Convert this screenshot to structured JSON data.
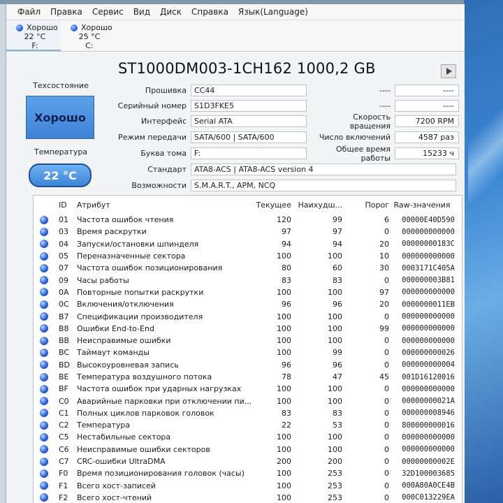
{
  "menu": [
    "Файл",
    "Правка",
    "Сервис",
    "Вид",
    "Диск",
    "Справка",
    "Язык(Language)"
  ],
  "disks": [
    {
      "status": "Хорошо",
      "temp": "22 °C",
      "letter": "F:"
    },
    {
      "status": "Хорошо",
      "temp": "25 °C",
      "letter": "C:"
    }
  ],
  "model_title": "ST1000DM003-1CH162 1000,2 GB",
  "left": {
    "health_label": "Техсостояние",
    "health_value": "Хорошо",
    "temp_label": "Температура",
    "temp_value": "22 °C"
  },
  "info": {
    "firmware": {
      "label": "Прошивка",
      "value": "CC44"
    },
    "serial": {
      "label": "Серийный номер",
      "value": "S1D3FKE5"
    },
    "interface": {
      "label": "Интерфейс",
      "value": "Serial ATA"
    },
    "transfer": {
      "label": "Режим передачи",
      "value": "SATA/600 | SATA/600"
    },
    "volume": {
      "label": "Буква тома",
      "value": "F:"
    },
    "standard": {
      "label": "Стандарт",
      "value": "ATA8-ACS | ATA8-ACS version 4"
    },
    "features": {
      "label": "Возможности",
      "value": "S.M.A.R.T., APM, NCQ"
    },
    "blank1": {
      "label": "----",
      "value": "----"
    },
    "blank2": {
      "label": "----",
      "value": "----"
    },
    "rpm": {
      "label": "Скорость вращения",
      "value": "7200 RPM"
    },
    "power_count": {
      "label": "Число включений",
      "value": "4587 раз"
    },
    "power_hours": {
      "label": "Общее время работы",
      "value": "15233 ч"
    }
  },
  "table": {
    "headers": {
      "id": "ID",
      "attr": "Атрибут",
      "current": "Текущее",
      "worst": "Наихудш...",
      "threshold": "Порог",
      "raw": "Raw-значения"
    },
    "rows": [
      {
        "id": "01",
        "attr": "Частота ошибок чтения",
        "current": "120",
        "worst": "99",
        "threshold": "6",
        "raw": "00000E40D590"
      },
      {
        "id": "03",
        "attr": "Время раскрутки",
        "current": "97",
        "worst": "97",
        "threshold": "0",
        "raw": "000000000000"
      },
      {
        "id": "04",
        "attr": "Запуски/остановки шпинделя",
        "current": "94",
        "worst": "94",
        "threshold": "20",
        "raw": "00000000183C"
      },
      {
        "id": "05",
        "attr": "Переназначенные сектора",
        "current": "100",
        "worst": "100",
        "threshold": "10",
        "raw": "000000000000"
      },
      {
        "id": "07",
        "attr": "Частота ошибок позиционирования",
        "current": "80",
        "worst": "60",
        "threshold": "30",
        "raw": "0003171C405A"
      },
      {
        "id": "09",
        "attr": "Часы работы",
        "current": "83",
        "worst": "83",
        "threshold": "0",
        "raw": "000000003B81"
      },
      {
        "id": "0A",
        "attr": "Повторные попытки раскрутки",
        "current": "100",
        "worst": "100",
        "threshold": "97",
        "raw": "000000000000"
      },
      {
        "id": "0C",
        "attr": "Включения/отключения",
        "current": "96",
        "worst": "96",
        "threshold": "20",
        "raw": "0000000011EB"
      },
      {
        "id": "B7",
        "attr": "Спецификации производителя",
        "current": "100",
        "worst": "100",
        "threshold": "0",
        "raw": "000000000000"
      },
      {
        "id": "B8",
        "attr": "Ошибки End-to-End",
        "current": "100",
        "worst": "100",
        "threshold": "99",
        "raw": "000000000000"
      },
      {
        "id": "BB",
        "attr": "Неисправимые ошибки",
        "current": "100",
        "worst": "100",
        "threshold": "0",
        "raw": "000000000000"
      },
      {
        "id": "BC",
        "attr": "Таймаут команды",
        "current": "100",
        "worst": "99",
        "threshold": "0",
        "raw": "000000000026"
      },
      {
        "id": "BD",
        "attr": "Высокоуровневая запись",
        "current": "96",
        "worst": "96",
        "threshold": "0",
        "raw": "000000000004"
      },
      {
        "id": "BE",
        "attr": "Температура воздушного потока",
        "current": "78",
        "worst": "47",
        "threshold": "45",
        "raw": "001D16120016"
      },
      {
        "id": "BF",
        "attr": "Частота ошибок при ударных нагрузках",
        "current": "100",
        "worst": "100",
        "threshold": "0",
        "raw": "000000000000"
      },
      {
        "id": "C0",
        "attr": "Аварийные парковки при отключении пи...",
        "current": "100",
        "worst": "100",
        "threshold": "0",
        "raw": "00000000021A"
      },
      {
        "id": "C1",
        "attr": "Полных циклов парковок головок",
        "current": "83",
        "worst": "83",
        "threshold": "0",
        "raw": "000000008946"
      },
      {
        "id": "C2",
        "attr": "Температура",
        "current": "22",
        "worst": "53",
        "threshold": "0",
        "raw": "800000000016"
      },
      {
        "id": "C5",
        "attr": "Нестабильные сектора",
        "current": "100",
        "worst": "100",
        "threshold": "0",
        "raw": "000000000000"
      },
      {
        "id": "C6",
        "attr": "Неисправимые ошибки секторов",
        "current": "100",
        "worst": "100",
        "threshold": "0",
        "raw": "000000000000"
      },
      {
        "id": "C7",
        "attr": "CRC-ошибки UltraDMA",
        "current": "200",
        "worst": "200",
        "threshold": "0",
        "raw": "00000000002E"
      },
      {
        "id": "F0",
        "attr": "Время позиционирования головок (часы)",
        "current": "100",
        "worst": "253",
        "threshold": "0",
        "raw": "32D100003685"
      },
      {
        "id": "F1",
        "attr": "Всего хост-записей",
        "current": "100",
        "worst": "253",
        "threshold": "0",
        "raw": "000A80A0CE4B"
      },
      {
        "id": "F2",
        "attr": "Всего хост-чтений",
        "current": "100",
        "worst": "253",
        "threshold": "0",
        "raw": "000C013229EA"
      }
    ]
  }
}
